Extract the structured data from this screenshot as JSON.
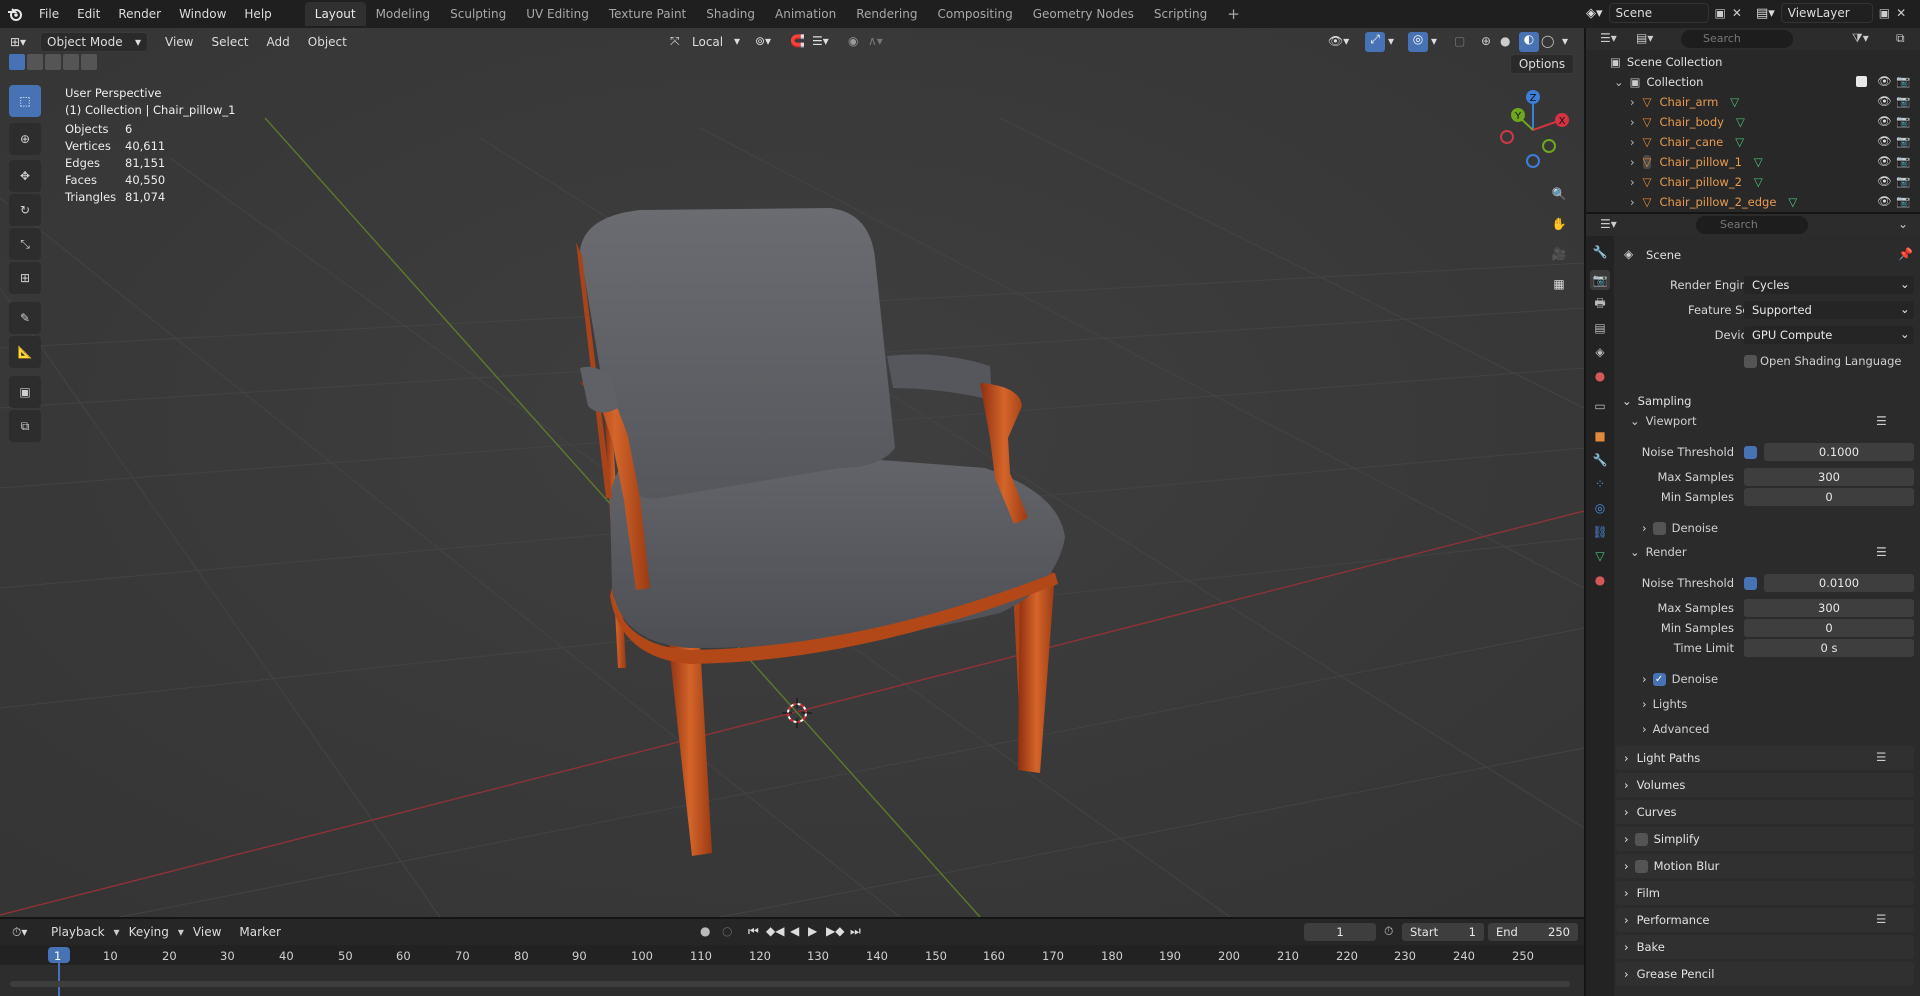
{
  "topbar": {
    "menus": [
      "File",
      "Edit",
      "Render",
      "Window",
      "Help"
    ],
    "workspaces": [
      "Layout",
      "Modeling",
      "Sculpting",
      "UV Editing",
      "Texture Paint",
      "Shading",
      "Animation",
      "Rendering",
      "Compositing",
      "Geometry Nodes",
      "Scripting"
    ],
    "active_workspace": "Layout",
    "add_workspace": "+",
    "scene_name": "Scene",
    "view_layer": "ViewLayer"
  },
  "viewport": {
    "mode": "Object Mode",
    "menus": [
      "View",
      "Select",
      "Add",
      "Object"
    ],
    "transform_orientation": "Local",
    "options_label": "Options",
    "overlay_title": "User Perspective",
    "overlay_subtitle": "(1) Collection | Chair_pillow_1",
    "stats": [
      {
        "label": "Objects",
        "value": "6"
      },
      {
        "label": "Vertices",
        "value": "40,611"
      },
      {
        "label": "Edges",
        "value": "81,151"
      },
      {
        "label": "Faces",
        "value": "40,550"
      },
      {
        "label": "Triangles",
        "value": "81,074"
      }
    ],
    "gizmo": {
      "x": "X",
      "y": "Y",
      "z": "Z"
    },
    "colors": {
      "x_axis": "#d6323f",
      "y_axis": "#6ea71e",
      "z_axis": "#3b7fd8",
      "wood": "#c0501e",
      "fabric": "#5b5d62"
    }
  },
  "outliner": {
    "search_placeholder": "Search",
    "root": "Scene Collection",
    "collection": "Collection",
    "items": [
      "Chair_arm",
      "Chair_body",
      "Chair_cane",
      "Chair_pillow_1",
      "Chair_pillow_2",
      "Chair_pillow_2_edge"
    ]
  },
  "properties": {
    "search_placeholder": "Search",
    "context": "Scene",
    "render_engine_label": "Render Engine",
    "render_engine": "Cycles",
    "feature_set_label": "Feature Set",
    "feature_set": "Supported",
    "device_label": "Device",
    "device": "GPU Compute",
    "osl_label": "Open Shading Language",
    "sampling": "Sampling",
    "viewport_section": "Viewport",
    "vp_noise_label": "Noise Threshold",
    "vp_noise": "0.1000",
    "vp_max_label": "Max Samples",
    "vp_max": "300",
    "vp_min_label": "Min Samples",
    "vp_min": "0",
    "vp_denoise_label": "Denoise",
    "render_section": "Render",
    "r_noise_label": "Noise Threshold",
    "r_noise": "0.0100",
    "r_max_label": "Max Samples",
    "r_max": "300",
    "r_min_label": "Min Samples",
    "r_min": "0",
    "r_time_label": "Time Limit",
    "r_time": "0 s",
    "r_denoise_label": "Denoise",
    "lights": "Lights",
    "advanced": "Advanced",
    "sections": [
      "Light Paths",
      "Volumes",
      "Curves",
      "Simplify",
      "Motion Blur",
      "Film",
      "Performance",
      "Bake",
      "Grease Pencil"
    ]
  },
  "timeline": {
    "menus": [
      "Playback",
      "Keying",
      "View",
      "Marker"
    ],
    "current_frame": "1",
    "start_label": "Start",
    "start": "1",
    "end_label": "End",
    "end": "250",
    "frames": [
      "1",
      "10",
      "20",
      "30",
      "40",
      "50",
      "60",
      "70",
      "80",
      "90",
      "100",
      "110",
      "120",
      "130",
      "140",
      "150",
      "160",
      "170",
      "180",
      "190",
      "200",
      "210",
      "220",
      "230",
      "240",
      "250"
    ]
  }
}
